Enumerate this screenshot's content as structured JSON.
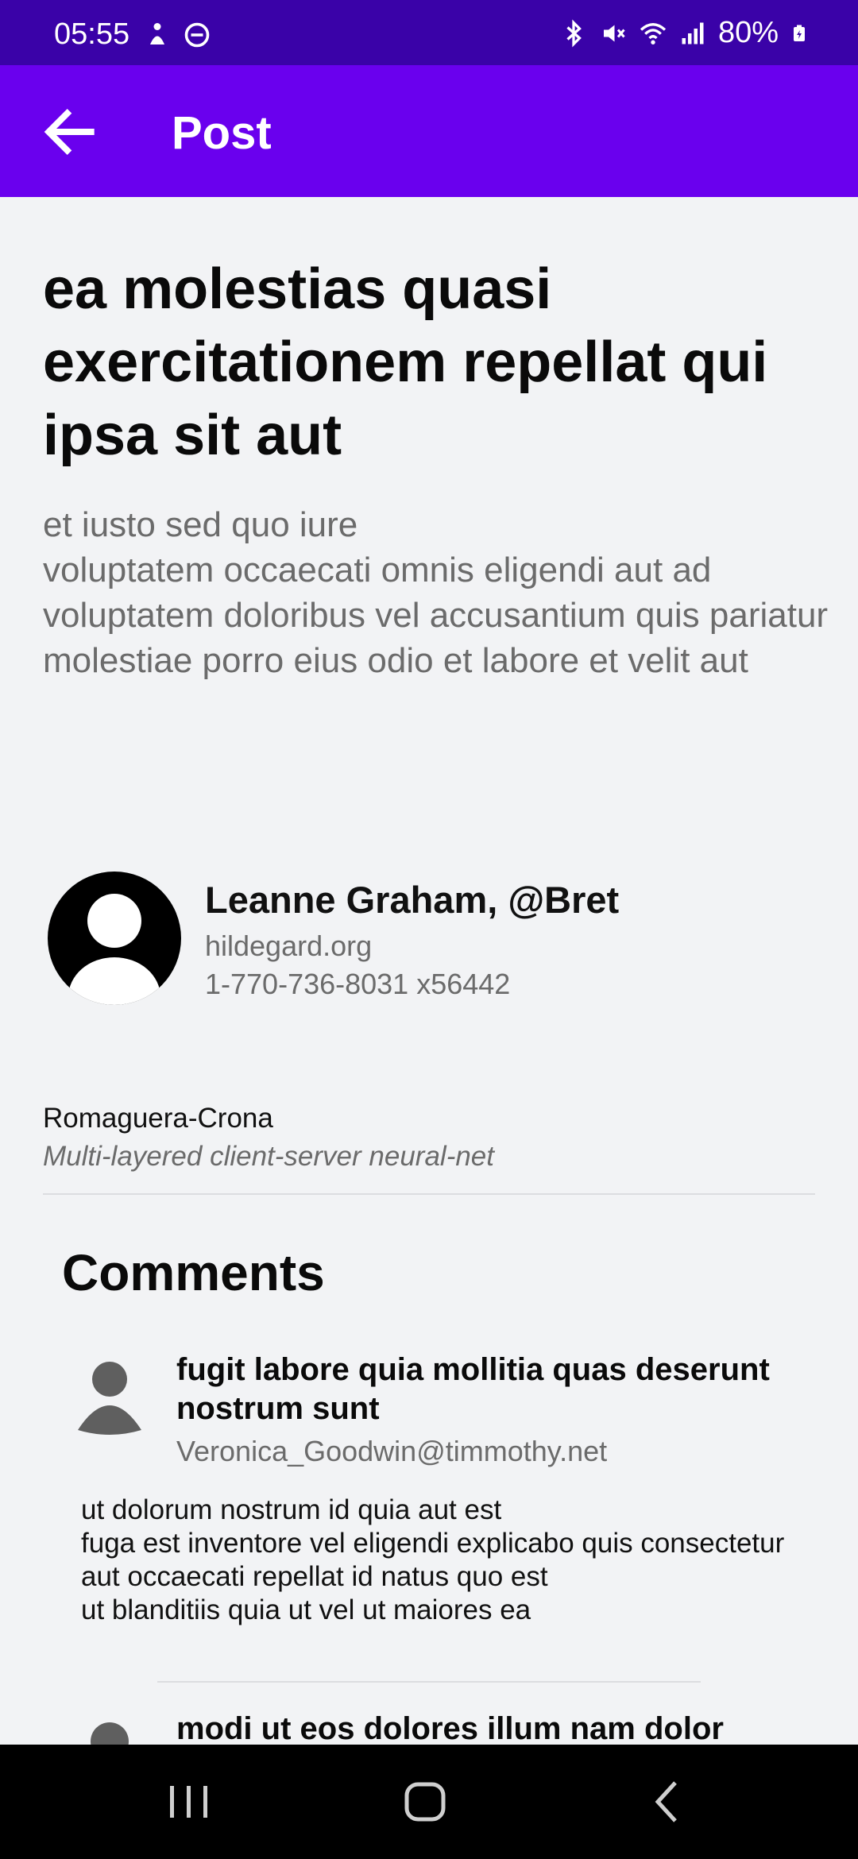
{
  "status_bar": {
    "time": "05:55",
    "battery": "80%",
    "left_icons": [
      "accessibility-icon",
      "do-not-disturb-icon"
    ],
    "right_icons": [
      "bluetooth-icon",
      "mute-icon",
      "wifi-icon",
      "signal-icon",
      "battery-icon"
    ]
  },
  "app_bar": {
    "title": "Post",
    "back_icon": "arrow-back-icon",
    "background": "#6a00ee"
  },
  "post": {
    "title": "ea molestias quasi exercitationem repellat qui ipsa sit aut",
    "body": "et iusto sed quo iure\nvoluptatem occaecati omnis eligendi aut ad\nvoluptatem doloribus vel accusantium quis pariatur\nmolestiae porro eius odio et labore et velit aut"
  },
  "author": {
    "name_handle": "Leanne Graham, @Bret",
    "website": "hildegard.org",
    "phone": "1-770-736-8031 x56442",
    "avatar_icon": "user-avatar-icon"
  },
  "company": {
    "name": "Romaguera-Crona",
    "catch_phrase": "Multi-layered client-server neural-net"
  },
  "comments": {
    "heading": "Comments",
    "items": [
      {
        "title": "fugit labore quia mollitia quas deserunt nostrum sunt",
        "email": "Veronica_Goodwin@timmothy.net",
        "body": "ut dolorum nostrum id quia aut est\nfuga est inventore vel eligendi explicabo quis consectetur\naut occaecati repellat id natus quo est\nut blanditiis quia ut vel ut maiores ea"
      },
      {
        "title": "modi ut eos dolores illum nam dolor"
      }
    ]
  },
  "nav_bar": {
    "icons": [
      "recent-apps-icon",
      "home-icon",
      "back-icon"
    ]
  }
}
